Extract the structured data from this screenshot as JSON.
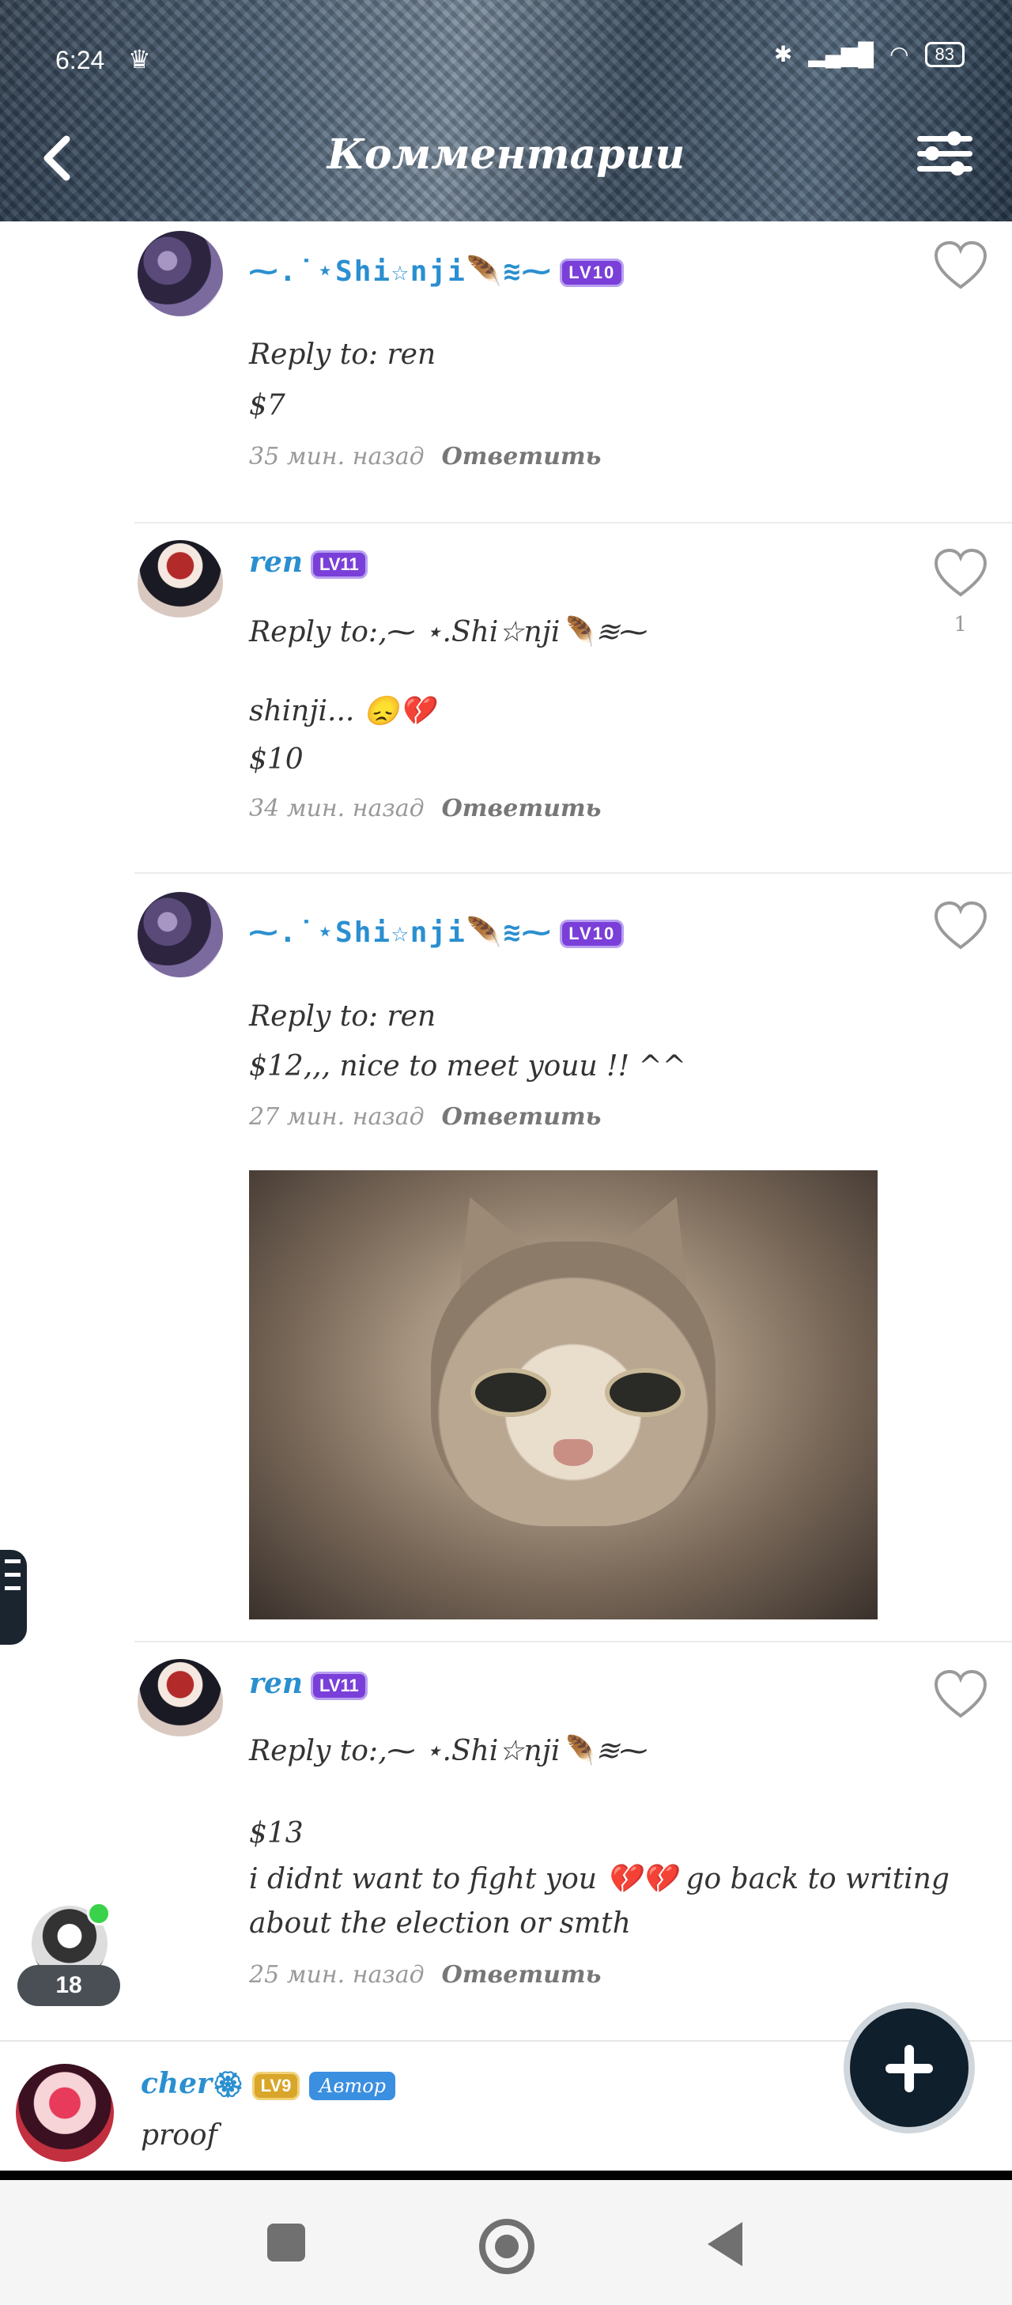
{
  "status_bar": {
    "time": "6:24",
    "battery": "83"
  },
  "header": {
    "title": "Комментарии"
  },
  "comments": [
    {
      "username": "⁓.˙⋆Shi☆nji🪶≋⁓",
      "level": "LV10",
      "reply_to": "Reply to: ren",
      "text": "$7",
      "time": "35 мин. назад",
      "reply_label": "Ответить"
    },
    {
      "username": "ren",
      "level": "LV11",
      "reply_to": "Reply to:‚⁓ ⋆.Shi☆nji🪶≋⁓",
      "text": "shinji... 😞💔",
      "text2": "$10",
      "likes": "1",
      "time": "34 мин. назад",
      "reply_label": "Ответить"
    },
    {
      "username": "⁓.˙⋆Shi☆nji🪶≋⁓",
      "level": "LV10",
      "reply_to": "Reply to: ren",
      "text": "$12,,, nice to meet youu !! ^^",
      "time": "27 мин. назад",
      "reply_label": "Ответить"
    },
    {
      "username": "ren",
      "level": "LV11",
      "reply_to": "Reply to:‚⁓ ⋆.Shi☆nji🪶≋⁓",
      "text": "$13",
      "text2": "i didnt want to fight you 💔💔 go back to writing",
      "text3": "about the election or smth",
      "time": "25 мин. назад",
      "reply_label": "Ответить"
    }
  ],
  "online": {
    "count": "18"
  },
  "bottom_comment": {
    "username": "cher",
    "level": "LV9",
    "badge": "Автор",
    "text": "proof"
  }
}
